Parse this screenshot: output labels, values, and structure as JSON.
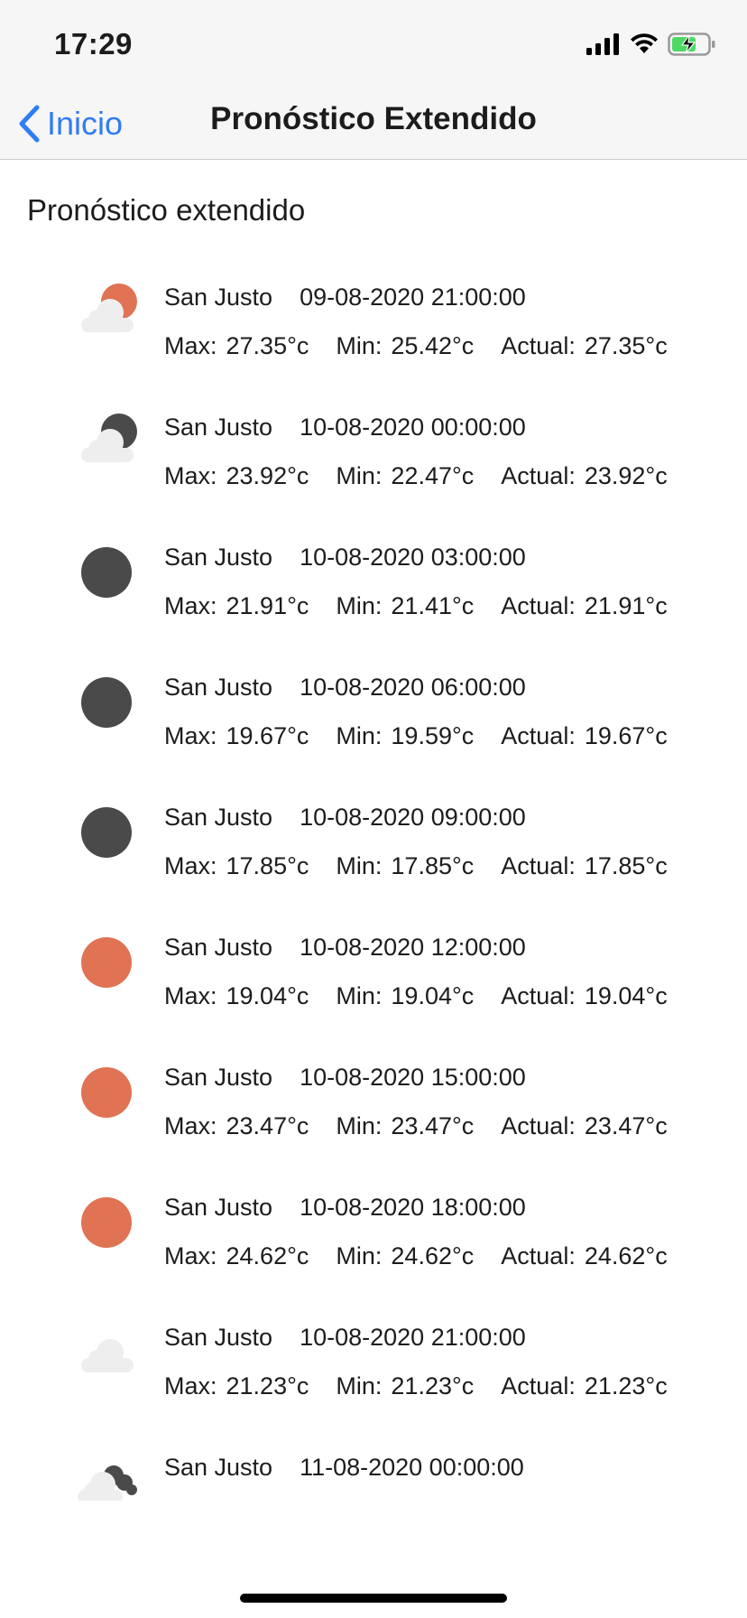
{
  "status_bar": {
    "time": "17:29",
    "icons": [
      "cellular-signal-icon",
      "wifi-icon",
      "battery-charging-icon"
    ]
  },
  "nav": {
    "back_label": "Inicio",
    "title": "Pronóstico Extendido"
  },
  "section_title": "Pronóstico extendido",
  "labels": {
    "max": "Max:",
    "min": "Min:",
    "actual": "Actual:"
  },
  "colors": {
    "accent": "#2f7cf6",
    "sun": "#e07353",
    "moon": "#4a4a4a",
    "cloud": "#eeeeee"
  },
  "forecast": [
    {
      "icon": "partly-cloudy-sun-icon",
      "city": "San Justo",
      "datetime": "09-08-2020 21:00:00",
      "max": "27.35°c",
      "min": "25.42°c",
      "actual": "27.35°c"
    },
    {
      "icon": "partly-cloudy-night-icon",
      "city": "San Justo",
      "datetime": "10-08-2020 00:00:00",
      "max": "23.92°c",
      "min": "22.47°c",
      "actual": "23.92°c"
    },
    {
      "icon": "moon-icon",
      "city": "San Justo",
      "datetime": "10-08-2020 03:00:00",
      "max": "21.91°c",
      "min": "21.41°c",
      "actual": "21.91°c"
    },
    {
      "icon": "moon-icon",
      "city": "San Justo",
      "datetime": "10-08-2020 06:00:00",
      "max": "19.67°c",
      "min": "19.59°c",
      "actual": "19.67°c"
    },
    {
      "icon": "moon-icon",
      "city": "San Justo",
      "datetime": "10-08-2020 09:00:00",
      "max": "17.85°c",
      "min": "17.85°c",
      "actual": "17.85°c"
    },
    {
      "icon": "sun-icon",
      "city": "San Justo",
      "datetime": "10-08-2020 12:00:00",
      "max": "19.04°c",
      "min": "19.04°c",
      "actual": "19.04°c"
    },
    {
      "icon": "sun-icon",
      "city": "San Justo",
      "datetime": "10-08-2020 15:00:00",
      "max": "23.47°c",
      "min": "23.47°c",
      "actual": "23.47°c"
    },
    {
      "icon": "sun-icon",
      "city": "San Justo",
      "datetime": "10-08-2020 18:00:00",
      "max": "24.62°c",
      "min": "24.62°c",
      "actual": "24.62°c"
    },
    {
      "icon": "cloud-icon",
      "city": "San Justo",
      "datetime": "10-08-2020 21:00:00",
      "max": "21.23°c",
      "min": "21.23°c",
      "actual": "21.23°c"
    },
    {
      "icon": "cloudy-night-icon",
      "city": "San Justo",
      "datetime": "11-08-2020 00:00:00",
      "max": "",
      "min": "",
      "actual": ""
    }
  ]
}
